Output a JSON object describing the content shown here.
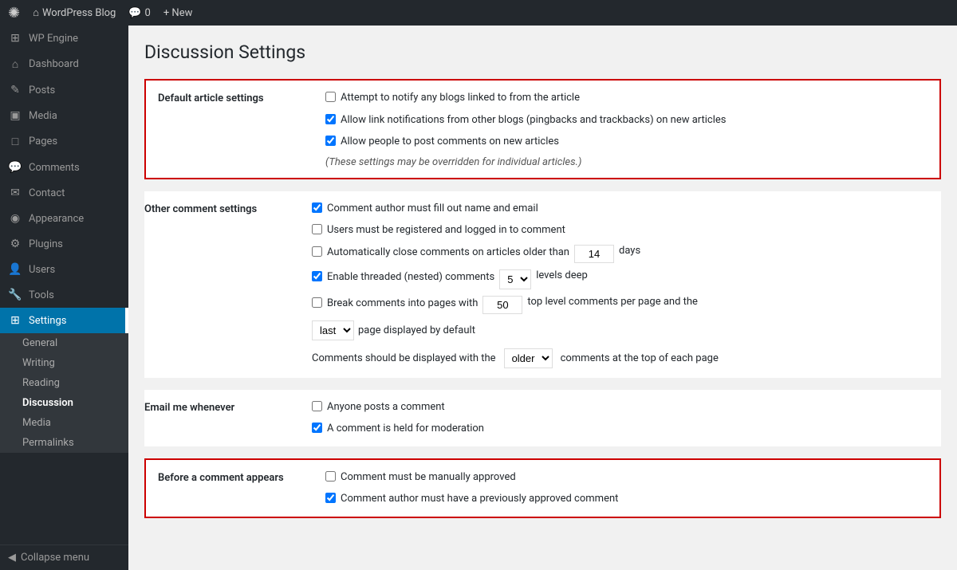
{
  "adminBar": {
    "wpLogo": "✺",
    "siteName": "WordPress Blog",
    "comments": "0",
    "newLabel": "+ New"
  },
  "sidebar": {
    "items": [
      {
        "id": "wp-engine",
        "label": "WP Engine",
        "icon": "⊞"
      },
      {
        "id": "dashboard",
        "label": "Dashboard",
        "icon": "⌂"
      },
      {
        "id": "posts",
        "label": "Posts",
        "icon": "✎"
      },
      {
        "id": "media",
        "label": "Media",
        "icon": "▣"
      },
      {
        "id": "pages",
        "label": "Pages",
        "icon": "□"
      },
      {
        "id": "comments",
        "label": "Comments",
        "icon": "💬"
      },
      {
        "id": "contact",
        "label": "Contact",
        "icon": "✉"
      },
      {
        "id": "appearance",
        "label": "Appearance",
        "icon": "◉"
      },
      {
        "id": "plugins",
        "label": "Plugins",
        "icon": "⚙"
      },
      {
        "id": "users",
        "label": "Users",
        "icon": "👤"
      },
      {
        "id": "tools",
        "label": "Tools",
        "icon": "🔧"
      },
      {
        "id": "settings",
        "label": "Settings",
        "icon": "⊞",
        "active": true
      }
    ],
    "settingsSubItems": [
      {
        "id": "general",
        "label": "General"
      },
      {
        "id": "writing",
        "label": "Writing"
      },
      {
        "id": "reading",
        "label": "Reading"
      },
      {
        "id": "discussion",
        "label": "Discussion",
        "active": true
      },
      {
        "id": "media",
        "label": "Media"
      },
      {
        "id": "permalinks",
        "label": "Permalinks"
      }
    ],
    "collapseLabel": "Collapse menu"
  },
  "pageTitle": "Discussion Settings",
  "sections": {
    "defaultArticle": {
      "label": "Default article settings",
      "highlighted": true,
      "checkboxes": [
        {
          "id": "notify-blogs",
          "checked": false,
          "label": "Attempt to notify any blogs linked to from the article"
        },
        {
          "id": "allow-pingbacks",
          "checked": true,
          "label": "Allow link notifications from other blogs (pingbacks and trackbacks) on new articles"
        },
        {
          "id": "allow-comments",
          "checked": true,
          "label": "Allow people to post comments on new articles"
        }
      ],
      "note": "(These settings may be overridden for individual articles.)"
    },
    "otherComments": {
      "label": "Other comment settings",
      "checkboxes": [
        {
          "id": "author-name-email",
          "checked": true,
          "label": "Comment author must fill out name and email"
        },
        {
          "id": "registered-logged-in",
          "checked": false,
          "label": "Users must be registered and logged in to comment"
        },
        {
          "id": "auto-close",
          "checked": false,
          "label": "Automatically close comments on articles older than",
          "hasInput": true,
          "inputValue": "14",
          "suffix": "days"
        },
        {
          "id": "threaded",
          "checked": true,
          "label": "Enable threaded (nested) comments",
          "hasSelect": true,
          "selectValue": "5",
          "suffix": "levels deep"
        },
        {
          "id": "break-pages",
          "checked": false,
          "label": "Break comments into pages with",
          "hasInput": true,
          "inputValue": "50",
          "suffix": "top level comments per page and the"
        }
      ],
      "pageDisplayRow": {
        "selectValue": "last",
        "suffix": "page displayed by default"
      },
      "displayOrderRow": {
        "prefix": "Comments should be displayed with the",
        "selectValue": "older",
        "suffix": "comments at the top of each page"
      }
    },
    "emailWhenever": {
      "label": "Email me whenever",
      "checkboxes": [
        {
          "id": "anyone-posts",
          "checked": false,
          "label": "Anyone posts a comment"
        },
        {
          "id": "held-moderation",
          "checked": true,
          "label": "A comment is held for moderation"
        }
      ]
    },
    "beforeAppears": {
      "label": "Before a comment appears",
      "highlighted": true,
      "checkboxes": [
        {
          "id": "manually-approved",
          "checked": false,
          "label": "Comment must be manually approved"
        },
        {
          "id": "previously-approved",
          "checked": true,
          "label": "Comment author must have a previously approved comment"
        }
      ]
    }
  }
}
